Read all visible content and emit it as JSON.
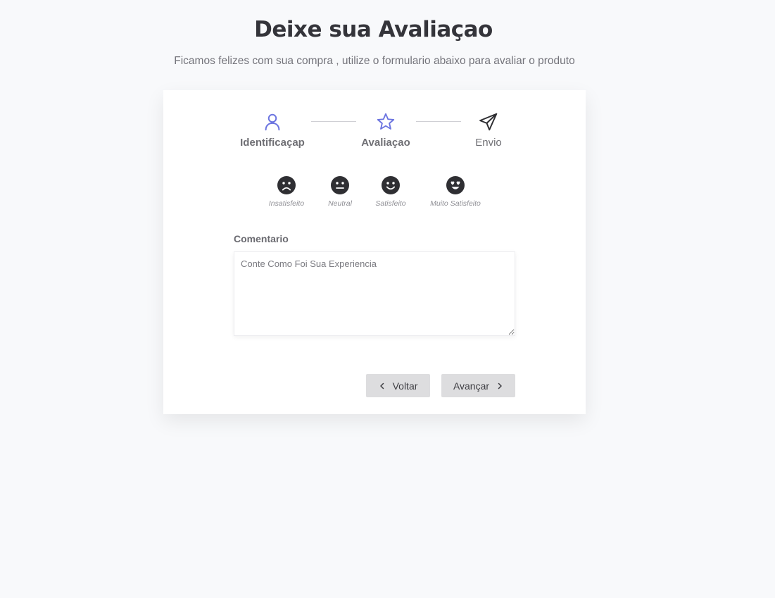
{
  "header": {
    "title": "Deixe sua Avaliaçao",
    "subtitle": "Ficamos felizes com sua compra , utilize o formulario abaixo para avaliar o produto"
  },
  "stepper": {
    "steps": [
      {
        "label": "Identificaçap",
        "icon": "user-icon",
        "state": "done"
      },
      {
        "label": "Avaliaçao",
        "icon": "star-icon",
        "state": "current"
      },
      {
        "label": "Envio",
        "icon": "send-icon",
        "state": "pending"
      }
    ]
  },
  "rating": {
    "options": [
      {
        "label": "Insatisfeito",
        "icon": "sad-face-icon"
      },
      {
        "label": "Neutral",
        "icon": "neutral-face-icon"
      },
      {
        "label": "Satisfeito",
        "icon": "smile-face-icon"
      },
      {
        "label": "Muito Satisfeito",
        "icon": "heart-eyes-face-icon"
      }
    ]
  },
  "comment": {
    "label": "Comentario",
    "placeholder": "Conte Como Foi Sua Experiencia",
    "value": ""
  },
  "actions": {
    "back_label": "Voltar",
    "next_label": "Avançar"
  },
  "colors": {
    "accent": "#6b74e0",
    "icon_dark": "#2f2f33",
    "button_bg": "#dddddf",
    "page_bg": "#f8f9fb"
  }
}
